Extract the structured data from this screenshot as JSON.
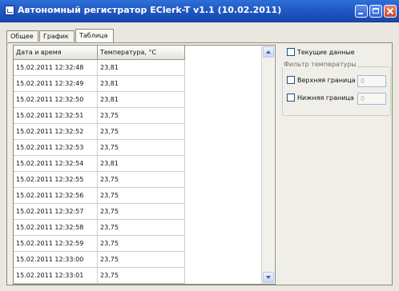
{
  "window": {
    "title": "Автономный регистратор EClerk-T v1.1 (10.02.2011)"
  },
  "tabs": [
    {
      "label": "Общее",
      "active": false
    },
    {
      "label": "График",
      "active": false
    },
    {
      "label": "Таблица",
      "active": true
    }
  ],
  "table": {
    "columns": [
      "Дата и время",
      "Температура, °C"
    ],
    "rows": [
      [
        "15.02.2011 12:32:48",
        "23,81"
      ],
      [
        "15.02.2011 12:32:49",
        "23,81"
      ],
      [
        "15.02.2011 12:32:50",
        "23,81"
      ],
      [
        "15.02.2011 12:32:51",
        "23,75"
      ],
      [
        "15.02.2011 12:32:52",
        "23,75"
      ],
      [
        "15.02.2011 12:32:53",
        "23,75"
      ],
      [
        "15.02.2011 12:32:54",
        "23,81"
      ],
      [
        "15.02.2011 12:32:55",
        "23,75"
      ],
      [
        "15.02.2011 12:32:56",
        "23,75"
      ],
      [
        "15.02.2011 12:32:57",
        "23,75"
      ],
      [
        "15.02.2011 12:32:58",
        "23,75"
      ],
      [
        "15.02.2011 12:32:59",
        "23,75"
      ],
      [
        "15.02.2011 12:33:00",
        "23,75"
      ],
      [
        "15.02.2011 12:33:01",
        "23,75"
      ]
    ]
  },
  "options": {
    "current_data_label": "Текущие данные",
    "filter_title": "Фильтр температуры",
    "upper_label": "Верхняя граница",
    "upper_value": "0",
    "lower_label": "Нижняя граница",
    "lower_value": "0"
  }
}
